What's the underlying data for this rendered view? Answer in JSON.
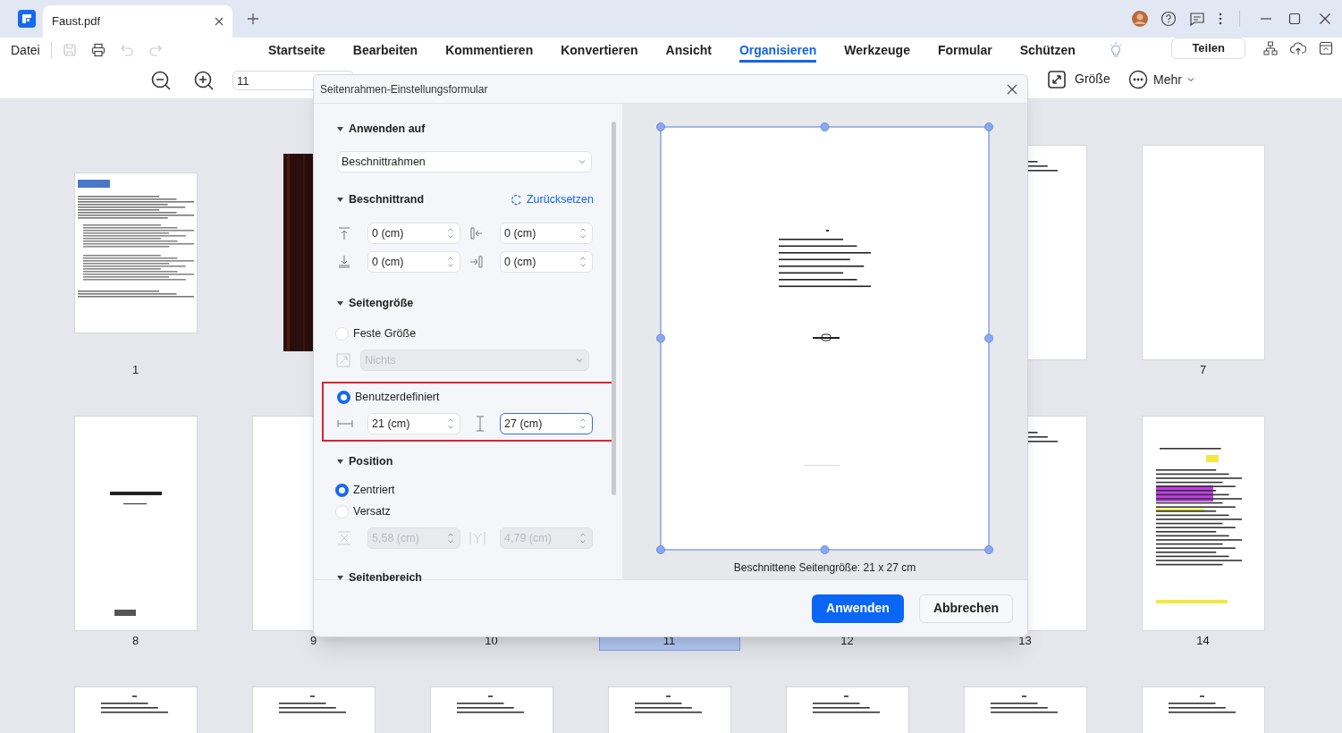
{
  "app_tabs": [
    {
      "title": "Faust.pdf",
      "selected": true
    }
  ],
  "menu": {
    "file": "Datei",
    "quick_actions": [
      {
        "kind": "save",
        "disabled": true
      },
      {
        "kind": "print",
        "disabled": false
      },
      {
        "kind": "undo",
        "disabled": true
      },
      {
        "kind": "redo",
        "disabled": true
      }
    ],
    "tabs": [
      {
        "label": "Startseite",
        "selected": false
      },
      {
        "label": "Bearbeiten",
        "selected": false
      },
      {
        "label": "Kommentieren",
        "selected": false
      },
      {
        "label": "Konvertieren",
        "selected": false
      },
      {
        "label": "Ansicht",
        "selected": false
      },
      {
        "label": "Organisieren",
        "selected": true
      },
      {
        "label": "Werkzeuge",
        "selected": false
      },
      {
        "label": "Formular",
        "selected": false
      },
      {
        "label": "Schützen",
        "selected": false
      }
    ],
    "share_button": "Teilen"
  },
  "toolbar": {
    "page_input": "11",
    "size_button": "Größe",
    "more_button": "Mehr"
  },
  "pages": [
    {
      "kind": "text",
      "label": "1",
      "selected": false
    },
    {
      "kind": "cover"
    },
    {
      "kind": "hidden"
    },
    {
      "kind": "hidden"
    },
    {
      "kind": "hidden"
    },
    {
      "kind": "verse"
    },
    {
      "kind": "blank",
      "label": "7",
      "selected": false
    },
    {
      "kind": "title",
      "label": "8",
      "selected": false
    },
    {
      "kind": "blank",
      "label": "9",
      "selected": false
    },
    {
      "kind": "hidden",
      "label": "10",
      "selected": false
    },
    {
      "kind": "hidden",
      "label": "11",
      "selected": true
    },
    {
      "kind": "hidden",
      "label": "12",
      "selected": false
    },
    {
      "kind": "verse",
      "label": "13",
      "selected": false
    },
    {
      "kind": "annotated",
      "label": "14",
      "selected": false
    },
    {
      "kind": "verse"
    },
    {
      "kind": "verse"
    },
    {
      "kind": "verse"
    },
    {
      "kind": "verse"
    },
    {
      "kind": "verse"
    },
    {
      "kind": "verse"
    },
    {
      "kind": "verse"
    }
  ],
  "dialog": {
    "title": "Seitenrahmen-Einstellungsformular",
    "apply_to": {
      "heading": "Anwenden auf",
      "value": "Beschnittrahmen"
    },
    "margins": {
      "heading": "Beschnittrand",
      "reset": "Zurücksetzen",
      "fields": [
        {
          "kind": "top",
          "value": "0 (cm)"
        },
        {
          "kind": "left",
          "value": "0 (cm)"
        },
        {
          "kind": "bottom",
          "value": "0 (cm)"
        },
        {
          "kind": "right",
          "value": "0 (cm)"
        }
      ]
    },
    "page_size": {
      "heading": "Seitengröße",
      "options": [
        {
          "label": "Feste Größe",
          "selected": false
        },
        {
          "label": "Benutzerdefiniert",
          "selected": true
        }
      ],
      "fixed_value": "Nichts",
      "width": {
        "value": "21 (cm)",
        "focused": false
      },
      "height": {
        "value": "27 (cm)",
        "focused": true
      },
      "highlighted": true
    },
    "position": {
      "heading": "Position",
      "options": [
        {
          "label": "Zentriert",
          "selected": true
        },
        {
          "label": "Versatz",
          "selected": false
        }
      ],
      "x": "5,58 (cm)",
      "y": "4,79 (cm)"
    },
    "page_range": {
      "heading": "Seitenbereich"
    },
    "preview_caption": "Beschnittene Seitengröße: 21 x 27 cm",
    "buttons": [
      {
        "label": "Anwenden",
        "kind": "primary"
      },
      {
        "label": "Abbrechen",
        "kind": "secondary"
      }
    ]
  }
}
